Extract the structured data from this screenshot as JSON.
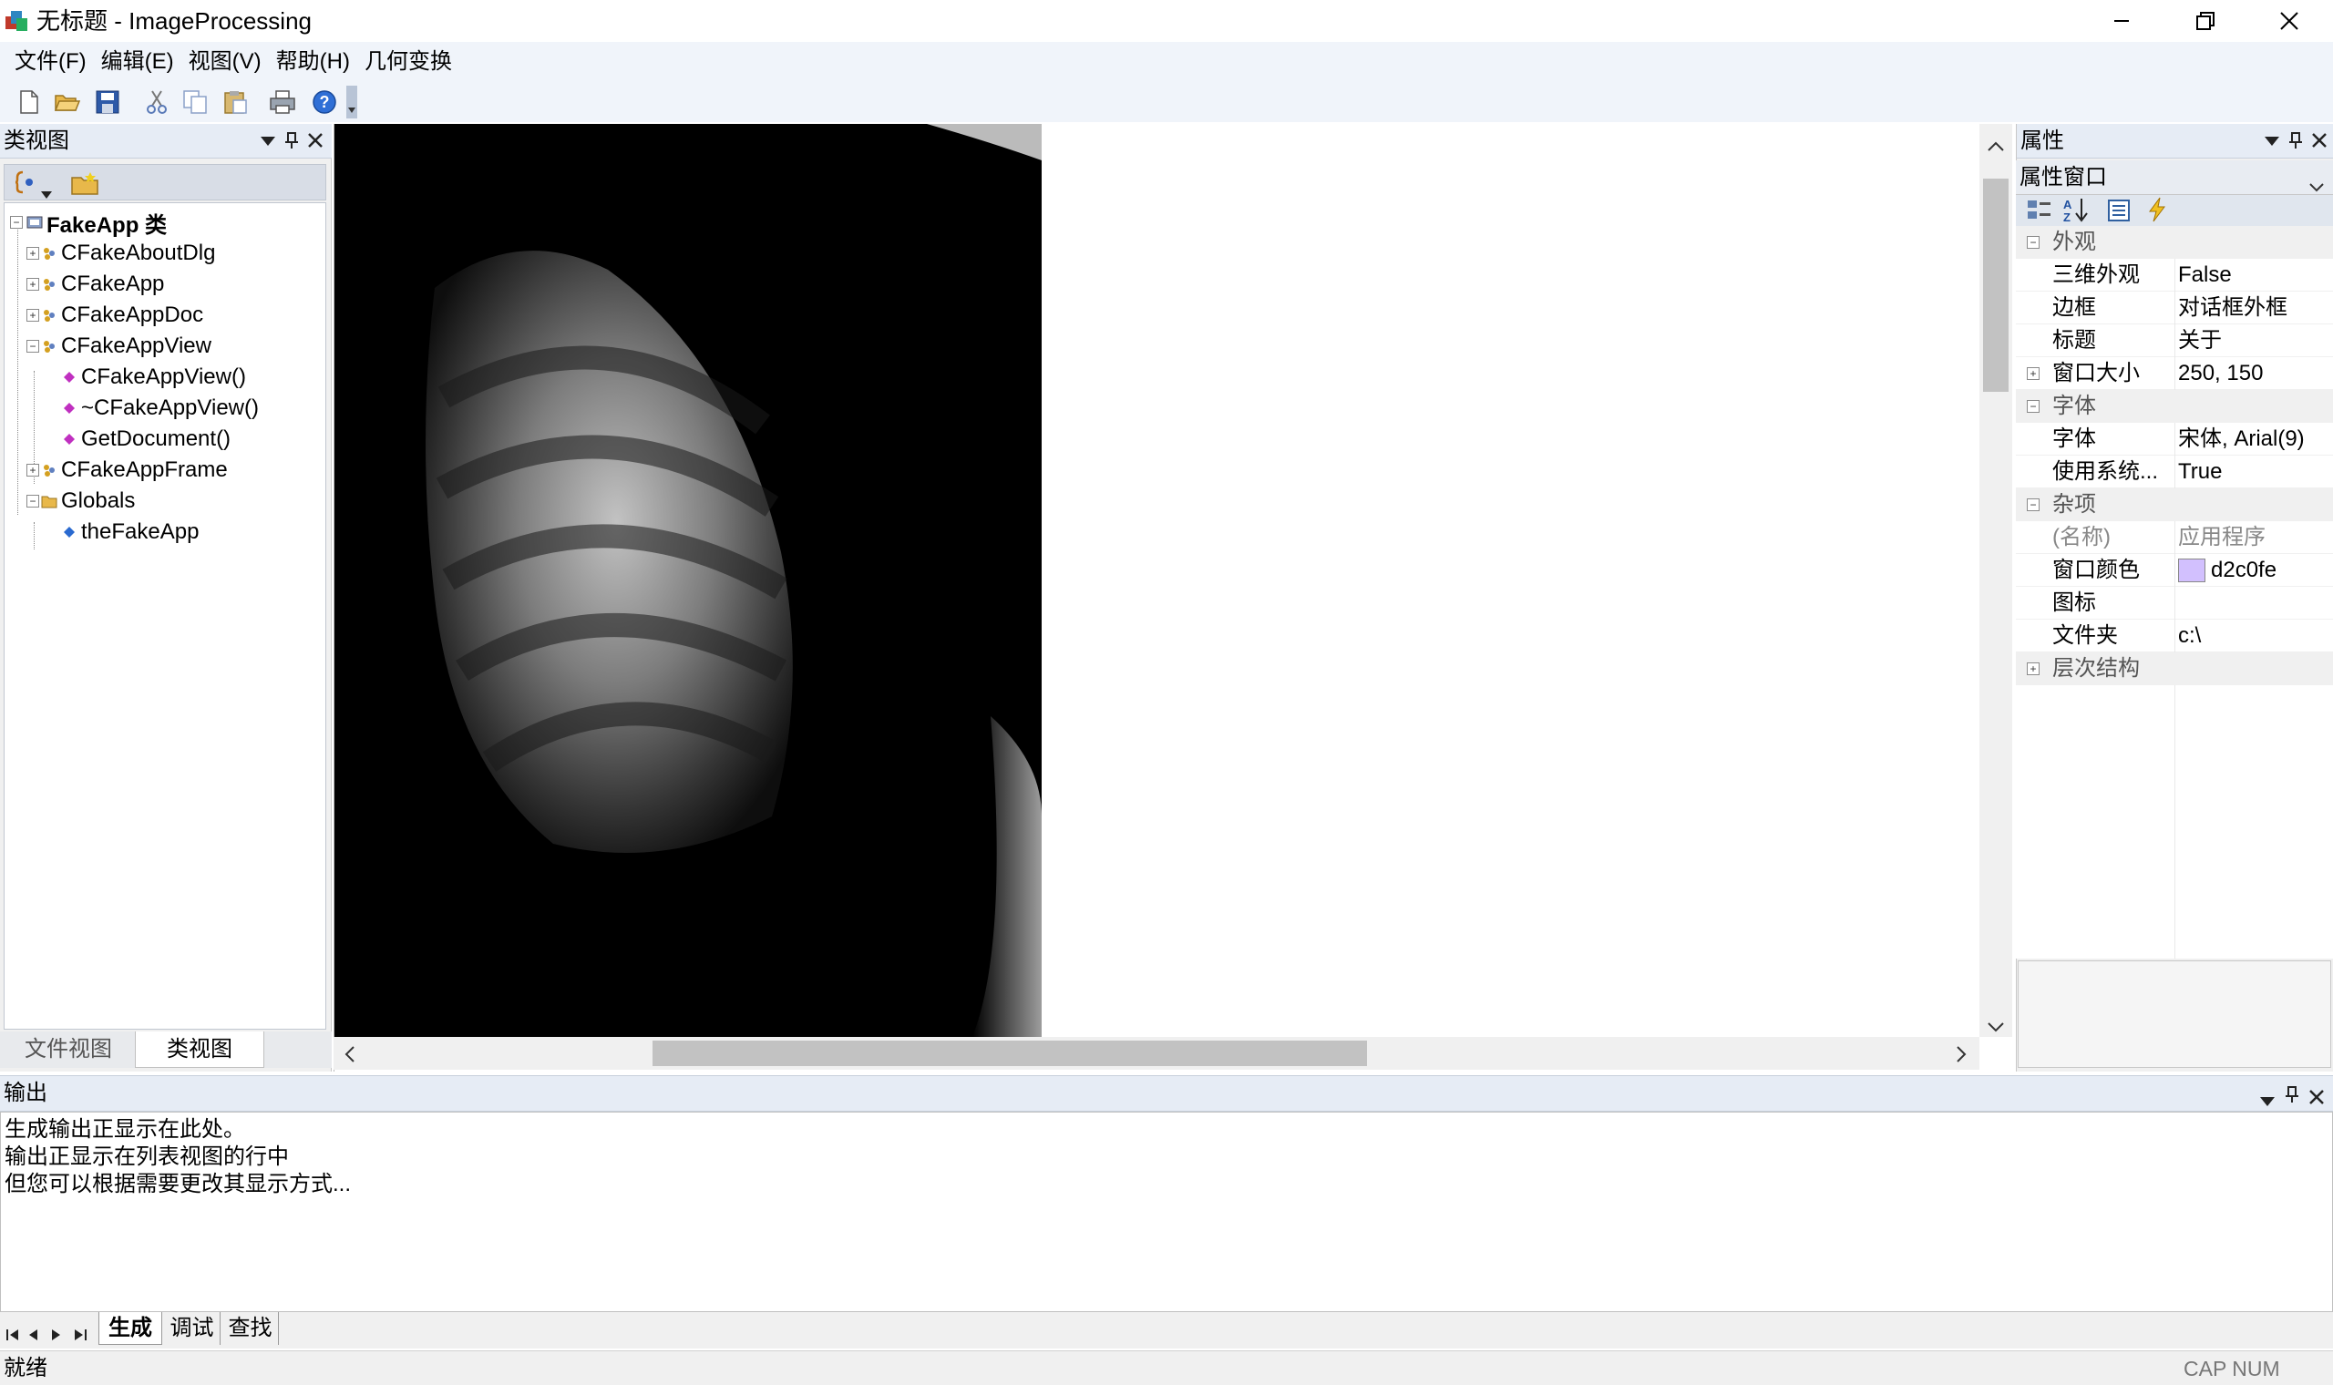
{
  "window": {
    "title": "无标题 - ImageProcessing"
  },
  "menu": [
    "文件(F)",
    "编辑(E)",
    "视图(V)",
    "帮助(H)",
    "几何变换"
  ],
  "toolbar": {
    "buttons": [
      "new-icon",
      "open-icon",
      "save-icon",
      "cut-icon",
      "copy-icon",
      "paste-icon",
      "print-icon",
      "help-icon"
    ]
  },
  "class_view": {
    "title": "类视图",
    "root": "FakeApp 类",
    "items": [
      "CFakeAboutDlg",
      "CFakeApp",
      "CFakeAppDoc",
      "CFakeAppView",
      "CFakeAppView()",
      "~CFakeAppView()",
      "GetDocument()",
      "CFakeAppFrame",
      "Globals",
      "theFakeApp"
    ],
    "tabs": [
      "文件视图",
      "类视图"
    ]
  },
  "properties": {
    "title": "属性",
    "combo": "属性窗口",
    "rows": [
      {
        "name": "外观",
        "value": ""
      },
      {
        "name": "三维外观",
        "value": "False"
      },
      {
        "name": "边框",
        "value": "对话框外框"
      },
      {
        "name": "标题",
        "value": "关于"
      },
      {
        "name": "窗口大小",
        "value": "250, 150"
      },
      {
        "name": "字体",
        "value": ""
      },
      {
        "name": "字体",
        "value": "宋体, Arial(9)"
      },
      {
        "name": "使用系统...",
        "value": "True"
      },
      {
        "name": "杂项",
        "value": ""
      },
      {
        "name": "(名称)",
        "value": "应用程序"
      },
      {
        "name": "窗口颜色",
        "value": "d2c0fe"
      },
      {
        "name": "图标",
        "value": ""
      },
      {
        "name": "文件夹",
        "value": "c:\\"
      },
      {
        "name": "层次结构",
        "value": ""
      }
    ],
    "swatch_color": "#d2c0fe"
  },
  "output": {
    "title": "输出",
    "lines": [
      "生成输出正显示在此处。",
      "输出正显示在列表视图的行中",
      "但您可以根据需要更改其显示方式..."
    ],
    "tabs": [
      "生成",
      "调试",
      "查找"
    ]
  },
  "status": {
    "text": "就绪",
    "indicators": "CAP NUM SCRL"
  }
}
